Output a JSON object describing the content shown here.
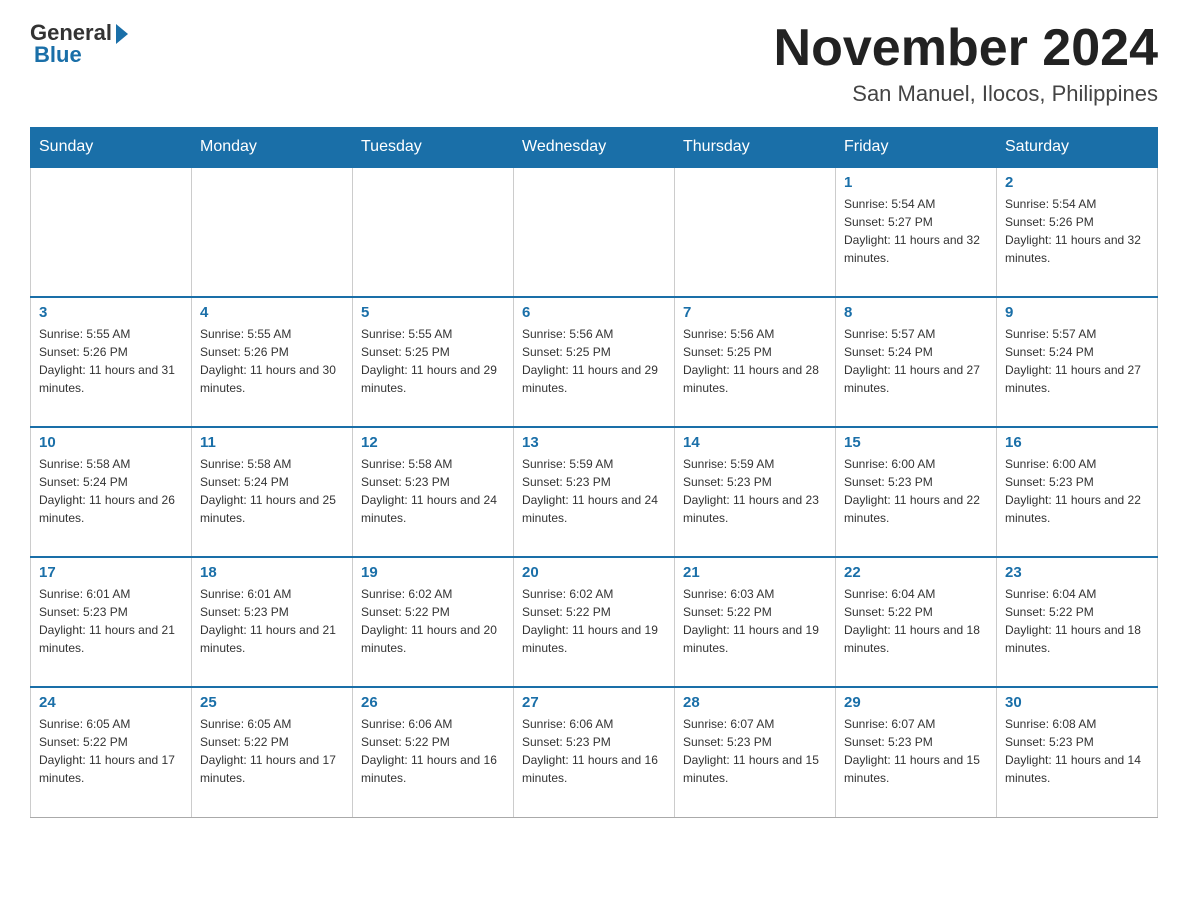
{
  "logo": {
    "general": "General",
    "blue": "Blue"
  },
  "title": "November 2024",
  "subtitle": "San Manuel, Ilocos, Philippines",
  "weekdays": [
    "Sunday",
    "Monday",
    "Tuesday",
    "Wednesday",
    "Thursday",
    "Friday",
    "Saturday"
  ],
  "weeks": [
    [
      {
        "day": "",
        "info": ""
      },
      {
        "day": "",
        "info": ""
      },
      {
        "day": "",
        "info": ""
      },
      {
        "day": "",
        "info": ""
      },
      {
        "day": "",
        "info": ""
      },
      {
        "day": "1",
        "info": "Sunrise: 5:54 AM\nSunset: 5:27 PM\nDaylight: 11 hours and 32 minutes."
      },
      {
        "day": "2",
        "info": "Sunrise: 5:54 AM\nSunset: 5:26 PM\nDaylight: 11 hours and 32 minutes."
      }
    ],
    [
      {
        "day": "3",
        "info": "Sunrise: 5:55 AM\nSunset: 5:26 PM\nDaylight: 11 hours and 31 minutes."
      },
      {
        "day": "4",
        "info": "Sunrise: 5:55 AM\nSunset: 5:26 PM\nDaylight: 11 hours and 30 minutes."
      },
      {
        "day": "5",
        "info": "Sunrise: 5:55 AM\nSunset: 5:25 PM\nDaylight: 11 hours and 29 minutes."
      },
      {
        "day": "6",
        "info": "Sunrise: 5:56 AM\nSunset: 5:25 PM\nDaylight: 11 hours and 29 minutes."
      },
      {
        "day": "7",
        "info": "Sunrise: 5:56 AM\nSunset: 5:25 PM\nDaylight: 11 hours and 28 minutes."
      },
      {
        "day": "8",
        "info": "Sunrise: 5:57 AM\nSunset: 5:24 PM\nDaylight: 11 hours and 27 minutes."
      },
      {
        "day": "9",
        "info": "Sunrise: 5:57 AM\nSunset: 5:24 PM\nDaylight: 11 hours and 27 minutes."
      }
    ],
    [
      {
        "day": "10",
        "info": "Sunrise: 5:58 AM\nSunset: 5:24 PM\nDaylight: 11 hours and 26 minutes."
      },
      {
        "day": "11",
        "info": "Sunrise: 5:58 AM\nSunset: 5:24 PM\nDaylight: 11 hours and 25 minutes."
      },
      {
        "day": "12",
        "info": "Sunrise: 5:58 AM\nSunset: 5:23 PM\nDaylight: 11 hours and 24 minutes."
      },
      {
        "day": "13",
        "info": "Sunrise: 5:59 AM\nSunset: 5:23 PM\nDaylight: 11 hours and 24 minutes."
      },
      {
        "day": "14",
        "info": "Sunrise: 5:59 AM\nSunset: 5:23 PM\nDaylight: 11 hours and 23 minutes."
      },
      {
        "day": "15",
        "info": "Sunrise: 6:00 AM\nSunset: 5:23 PM\nDaylight: 11 hours and 22 minutes."
      },
      {
        "day": "16",
        "info": "Sunrise: 6:00 AM\nSunset: 5:23 PM\nDaylight: 11 hours and 22 minutes."
      }
    ],
    [
      {
        "day": "17",
        "info": "Sunrise: 6:01 AM\nSunset: 5:23 PM\nDaylight: 11 hours and 21 minutes."
      },
      {
        "day": "18",
        "info": "Sunrise: 6:01 AM\nSunset: 5:23 PM\nDaylight: 11 hours and 21 minutes."
      },
      {
        "day": "19",
        "info": "Sunrise: 6:02 AM\nSunset: 5:22 PM\nDaylight: 11 hours and 20 minutes."
      },
      {
        "day": "20",
        "info": "Sunrise: 6:02 AM\nSunset: 5:22 PM\nDaylight: 11 hours and 19 minutes."
      },
      {
        "day": "21",
        "info": "Sunrise: 6:03 AM\nSunset: 5:22 PM\nDaylight: 11 hours and 19 minutes."
      },
      {
        "day": "22",
        "info": "Sunrise: 6:04 AM\nSunset: 5:22 PM\nDaylight: 11 hours and 18 minutes."
      },
      {
        "day": "23",
        "info": "Sunrise: 6:04 AM\nSunset: 5:22 PM\nDaylight: 11 hours and 18 minutes."
      }
    ],
    [
      {
        "day": "24",
        "info": "Sunrise: 6:05 AM\nSunset: 5:22 PM\nDaylight: 11 hours and 17 minutes."
      },
      {
        "day": "25",
        "info": "Sunrise: 6:05 AM\nSunset: 5:22 PM\nDaylight: 11 hours and 17 minutes."
      },
      {
        "day": "26",
        "info": "Sunrise: 6:06 AM\nSunset: 5:22 PM\nDaylight: 11 hours and 16 minutes."
      },
      {
        "day": "27",
        "info": "Sunrise: 6:06 AM\nSunset: 5:23 PM\nDaylight: 11 hours and 16 minutes."
      },
      {
        "day": "28",
        "info": "Sunrise: 6:07 AM\nSunset: 5:23 PM\nDaylight: 11 hours and 15 minutes."
      },
      {
        "day": "29",
        "info": "Sunrise: 6:07 AM\nSunset: 5:23 PM\nDaylight: 11 hours and 15 minutes."
      },
      {
        "day": "30",
        "info": "Sunrise: 6:08 AM\nSunset: 5:23 PM\nDaylight: 11 hours and 14 minutes."
      }
    ]
  ]
}
